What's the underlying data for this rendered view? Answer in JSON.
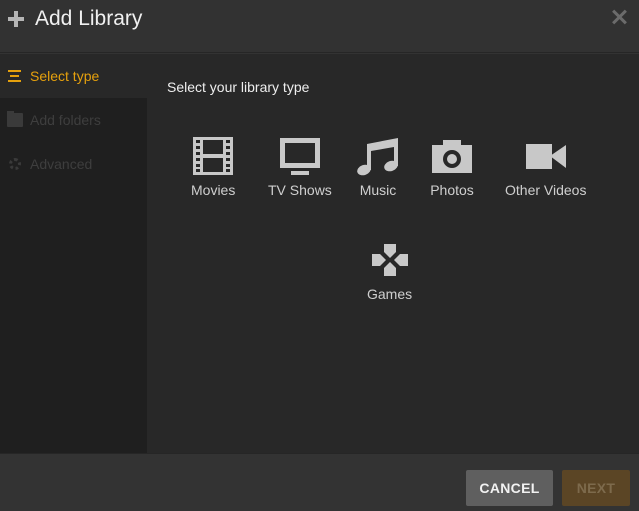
{
  "header": {
    "title": "Add Library",
    "icon": "plus-icon",
    "close_icon": "close-icon"
  },
  "sidebar": {
    "items": [
      {
        "label": "Select type",
        "icon": "list-icon",
        "state": "active"
      },
      {
        "label": "Add folders",
        "icon": "folder-icon",
        "state": "disabled"
      },
      {
        "label": "Advanced",
        "icon": "gear-icon",
        "state": "disabled"
      }
    ]
  },
  "main": {
    "prompt": "Select your library type",
    "types": [
      {
        "label": "Movies",
        "icon": "film-icon"
      },
      {
        "label": "TV Shows",
        "icon": "tv-icon"
      },
      {
        "label": "Music",
        "icon": "music-note-icon"
      },
      {
        "label": "Photos",
        "icon": "camera-icon"
      },
      {
        "label": "Other Videos",
        "icon": "video-camera-icon"
      },
      {
        "label": "Games",
        "icon": "gamepad-icon"
      }
    ]
  },
  "footer": {
    "cancel_label": "CANCEL",
    "next_label": "NEXT"
  },
  "colors": {
    "accent": "#e5a00d",
    "icon": "#c8c8c8"
  }
}
